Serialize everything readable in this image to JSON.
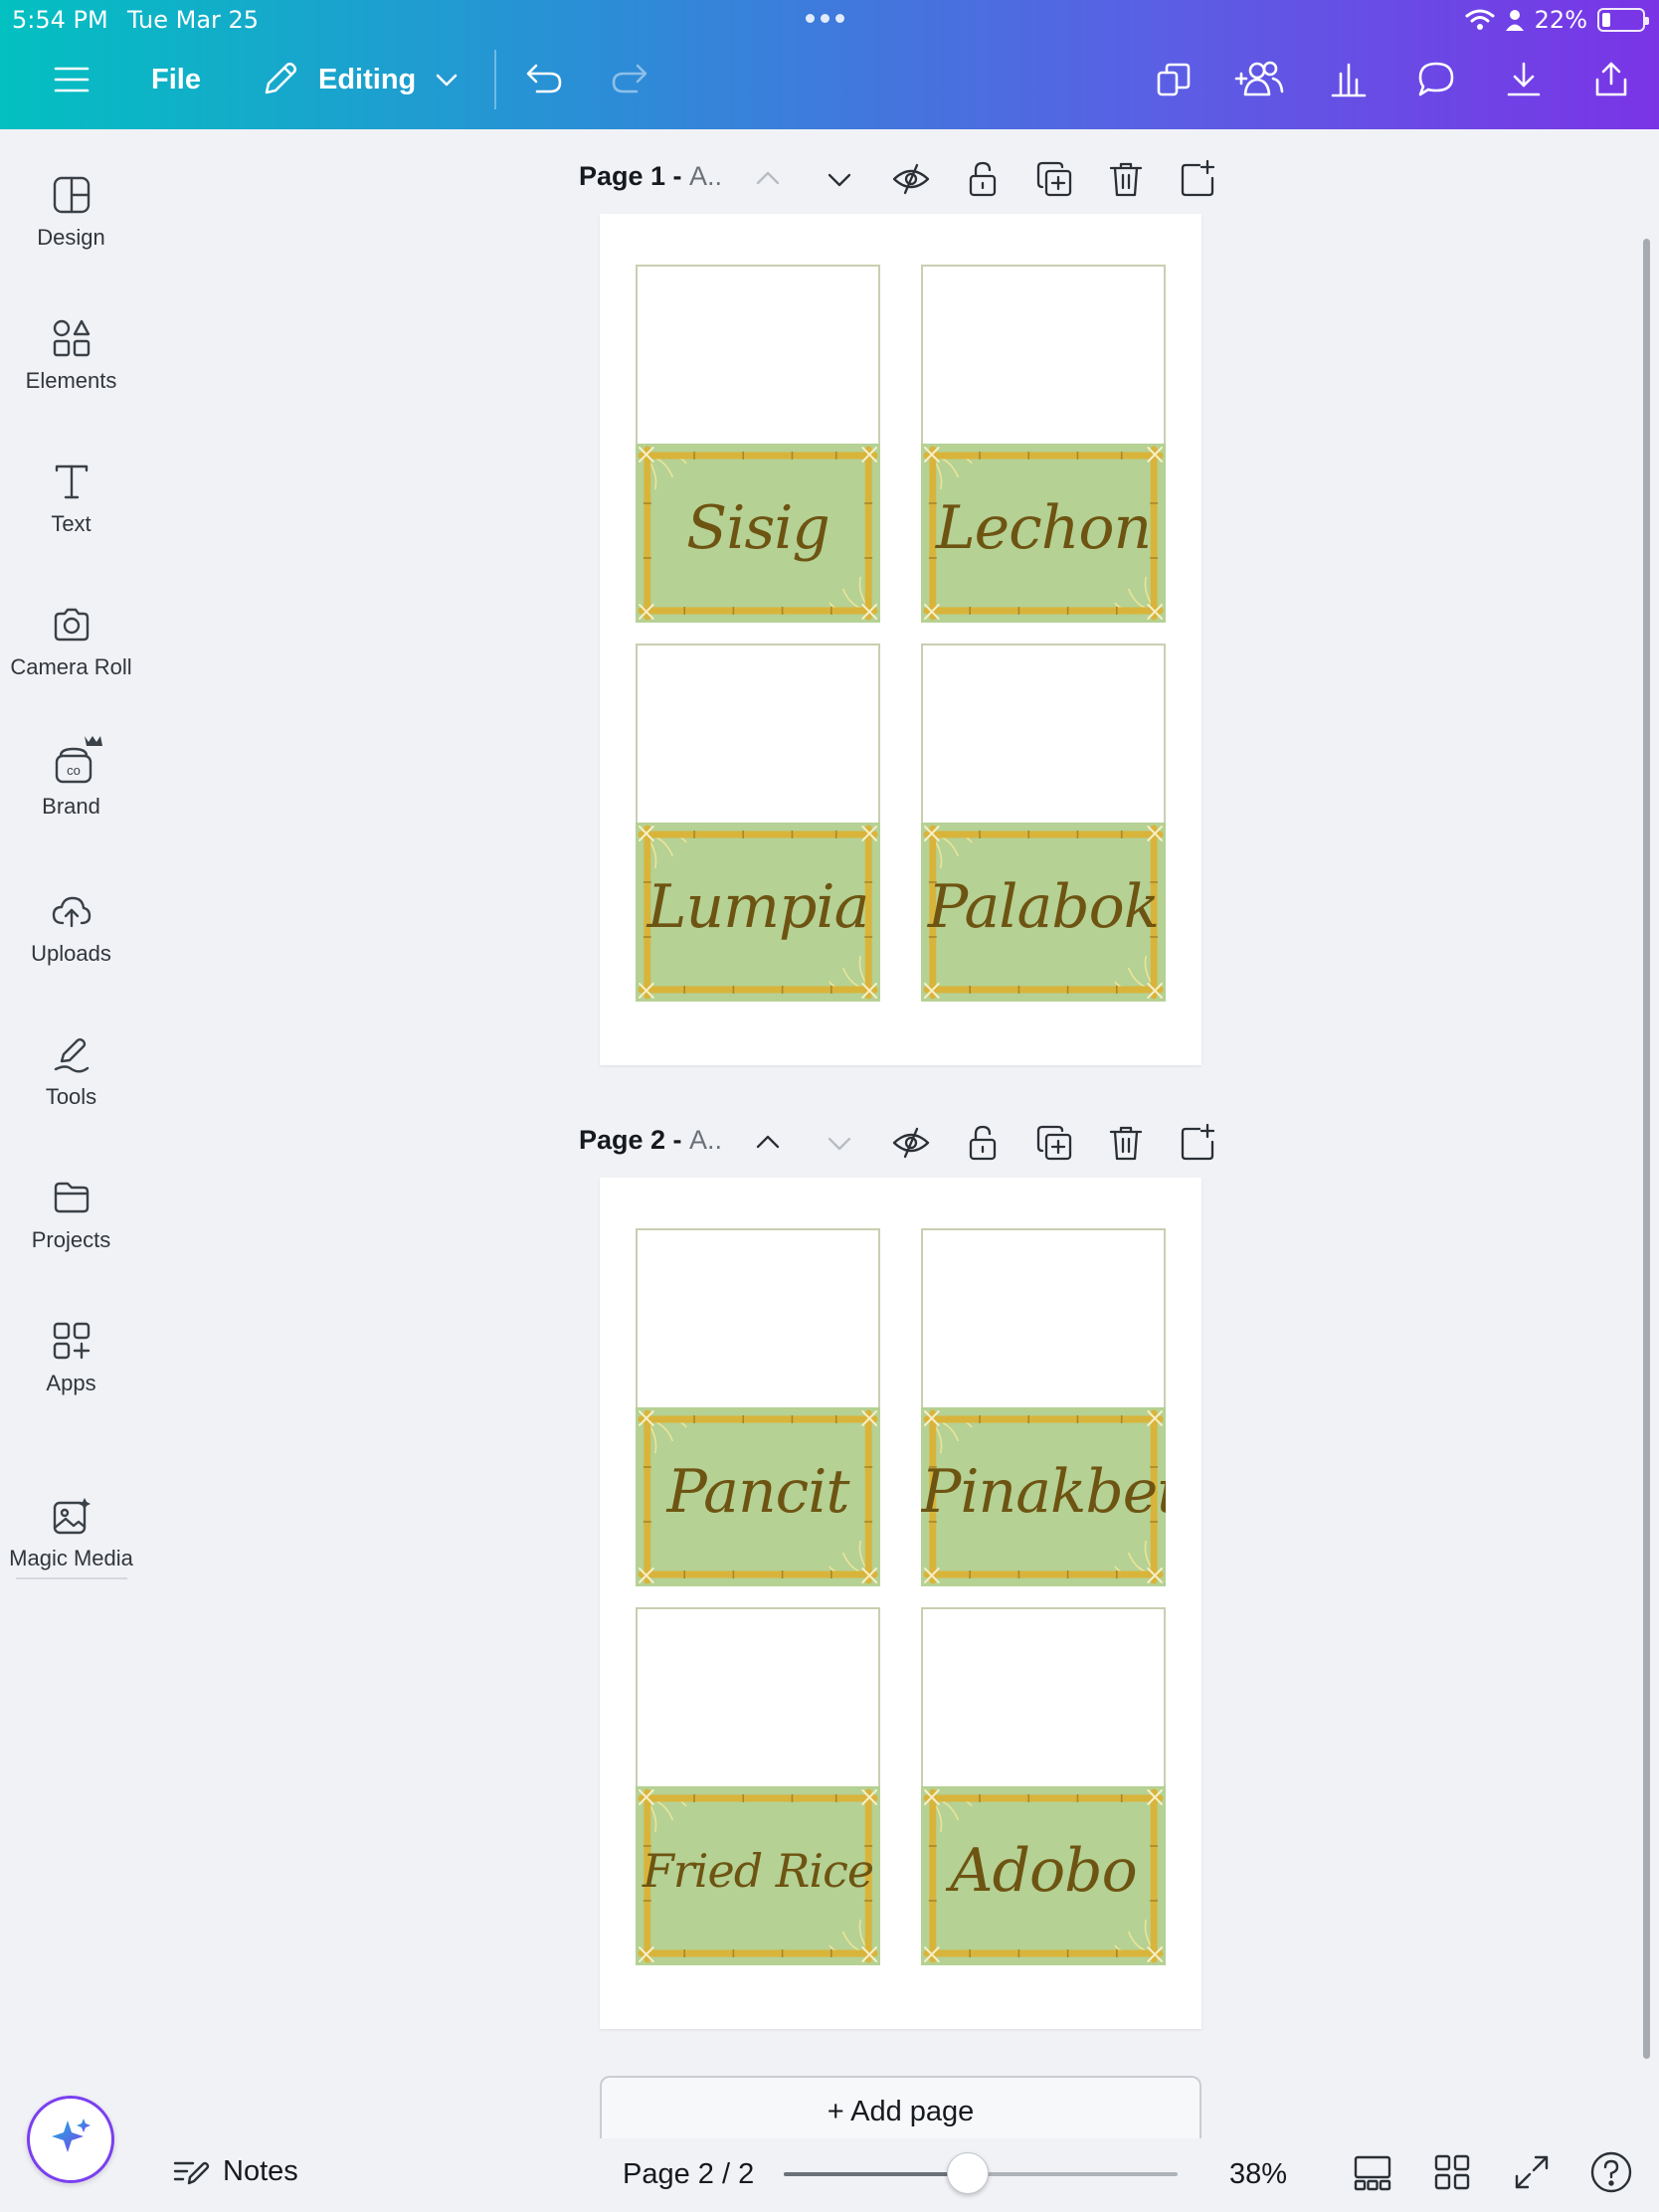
{
  "status_bar": {
    "time": "5:54 PM",
    "date": "Tue Mar 25",
    "battery": "22%",
    "battery_level": 0.22
  },
  "toolbar": {
    "file_label": "File",
    "editing_label": "Editing"
  },
  "sidebar": {
    "items": [
      {
        "label": "Design",
        "icon": "layout-icon"
      },
      {
        "label": "Elements",
        "icon": "shapes-icon"
      },
      {
        "label": "Text",
        "icon": "text-icon"
      },
      {
        "label": "Camera Roll",
        "icon": "camera-icon"
      },
      {
        "label": "Brand",
        "icon": "brand-icon"
      },
      {
        "label": "Uploads",
        "icon": "cloud-upload-icon"
      },
      {
        "label": "Tools",
        "icon": "pen-icon"
      },
      {
        "label": "Projects",
        "icon": "folder-icon"
      },
      {
        "label": "Apps",
        "icon": "apps-icon"
      },
      {
        "label": "Magic Media",
        "icon": "magic-media-icon"
      }
    ]
  },
  "pages": [
    {
      "title": "Page 1 - ",
      "title_dim": "A..",
      "cards": [
        "Sisig",
        "Lechon",
        "Lumpia",
        "Palabok"
      ]
    },
    {
      "title": "Page 2 - ",
      "title_dim": "A..",
      "cards": [
        "Pancit",
        "Pinakbet",
        "Fried Rice",
        "Adobo"
      ]
    }
  ],
  "add_page_label": "+  Add page",
  "bottom_bar": {
    "notes_label": "Notes",
    "page_indicator": "Page 2 / 2",
    "zoom": "38%",
    "zoom_value": 38
  },
  "colors": {
    "accent": "#7a3ff0",
    "card_green": "#b5d194",
    "card_text": "#6e5412",
    "bamboo": "#d9b43a"
  }
}
